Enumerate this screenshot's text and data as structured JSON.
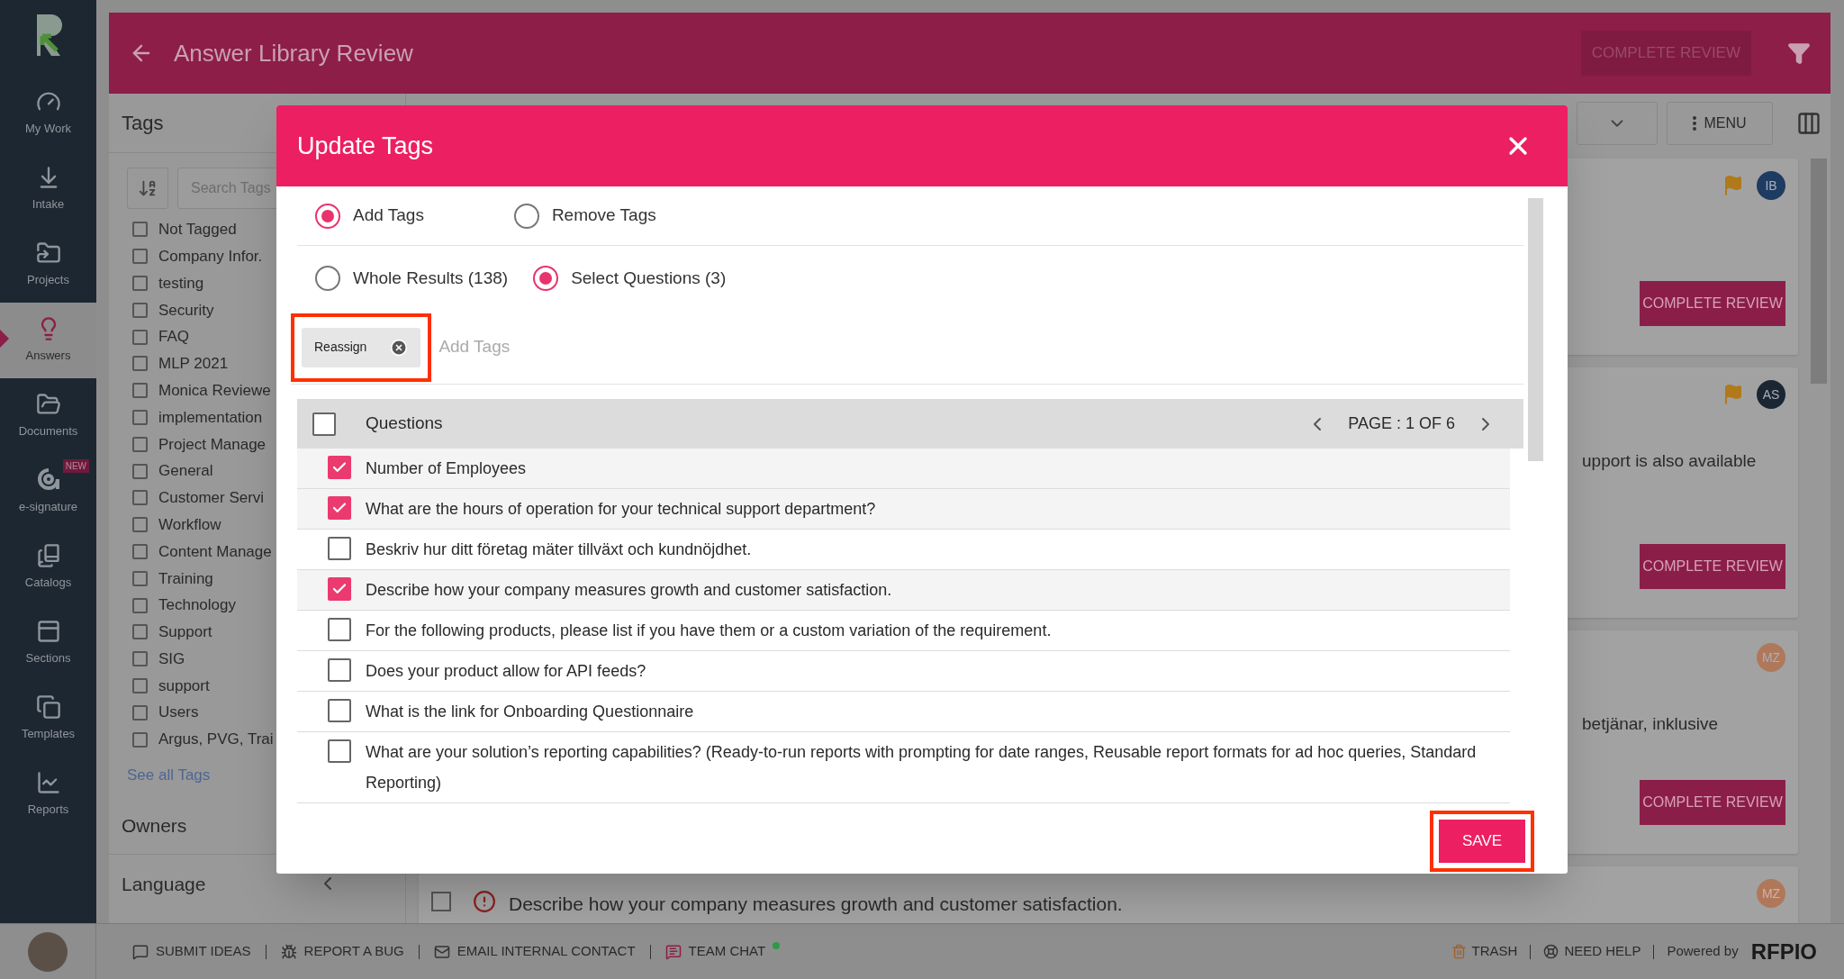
{
  "sidebar": {
    "items": [
      {
        "label": "My Work",
        "selected": false
      },
      {
        "label": "Intake",
        "selected": false
      },
      {
        "label": "Projects",
        "selected": false
      },
      {
        "label": "Answers",
        "selected": true
      },
      {
        "label": "Documents",
        "selected": false
      },
      {
        "label": "e-signature",
        "selected": false,
        "badge": "NEW"
      },
      {
        "label": "Catalogs",
        "selected": false
      },
      {
        "label": "Sections",
        "selected": false
      },
      {
        "label": "Templates",
        "selected": false
      },
      {
        "label": "Reports",
        "selected": false
      }
    ]
  },
  "header": {
    "title": "Answer Library Review",
    "action": "COMPLETE REVIEW"
  },
  "toolbar": {
    "menu": "MENU"
  },
  "tags_panel": {
    "title": "Tags",
    "search_placeholder": "Search Tags",
    "items": [
      {
        "label": "Not Tagged",
        "checked": false
      },
      {
        "label": "Company Infor.",
        "checked": false
      },
      {
        "label": "testing",
        "checked": false
      },
      {
        "label": "Security",
        "checked": false
      },
      {
        "label": "FAQ",
        "checked": false
      },
      {
        "label": "MLP 2021",
        "checked": false
      },
      {
        "label": "Monica Reviewe",
        "checked": false
      },
      {
        "label": "implementation",
        "checked": false
      },
      {
        "label": "Project Manage",
        "checked": false
      },
      {
        "label": "General",
        "checked": false
      },
      {
        "label": "Customer Servi",
        "checked": false
      },
      {
        "label": "Workflow",
        "checked": false
      },
      {
        "label": "Content Manage",
        "checked": false
      },
      {
        "label": "Training",
        "checked": false
      },
      {
        "label": "Technology",
        "checked": false
      },
      {
        "label": "Support",
        "checked": false
      },
      {
        "label": "SIG",
        "checked": false
      },
      {
        "label": "support",
        "checked": false
      },
      {
        "label": "Users",
        "checked": false
      },
      {
        "label": "Argus, PVG, Trai",
        "checked": false
      }
    ],
    "see_all": "See all Tags",
    "sections": [
      "Owners",
      "Language"
    ]
  },
  "cards": [
    {
      "kind": "review",
      "avatar": "IB",
      "color": "#1e3b61",
      "flagged": true,
      "button": "COMPLETE REVIEW"
    },
    {
      "kind": "review",
      "avatar": "AS",
      "color": "#1b2633",
      "flagged": true,
      "text": "upport is also available",
      "button": "COMPLETE REVIEW"
    },
    {
      "kind": "review",
      "avatar": "MZ",
      "color": "#b0785a",
      "flagged": false,
      "text": "betjänar, inklusive",
      "button": "COMPLETE REVIEW"
    },
    {
      "kind": "question",
      "avatar": "MZ",
      "color": "#b0785a",
      "checked": false,
      "text": "Describe how your company measures growth and customer satisfaction."
    }
  ],
  "modal": {
    "title": "Update Tags",
    "mode_options": [
      {
        "label": "Add Tags",
        "selected": true
      },
      {
        "label": "Remove Tags",
        "selected": false
      }
    ],
    "scope_options": [
      {
        "label": "Whole Results (138)",
        "selected": false
      },
      {
        "label": "Select Questions (3)",
        "selected": true
      }
    ],
    "tags": [
      "Reassign"
    ],
    "tag_placeholder": "Add Tags",
    "table": {
      "header": "Questions",
      "all_checked": false,
      "page": "PAGE : 1 OF 6",
      "rows": [
        {
          "text": "Number of Employees",
          "checked": true
        },
        {
          "text": "What are the hours of operation for your technical support department?",
          "checked": true
        },
        {
          "text": "Beskriv hur ditt företag mäter tillväxt och kundnöjdhet.",
          "checked": false
        },
        {
          "text": "Describe how your company measures growth and customer satisfaction.",
          "checked": true
        },
        {
          "text": "For the following products, please list if you have them or a custom variation of the requirement.",
          "checked": false
        },
        {
          "text": "Does your product allow for API feeds?",
          "checked": false
        },
        {
          "text": "What is the link for Onboarding Questionnaire",
          "checked": false
        },
        {
          "text": "What are your solution’s reporting capabilities? (Ready-to-run reports with prompting for date ranges, Reusable report formats for ad hoc queries, Standard Reporting)",
          "checked": false
        }
      ]
    },
    "save": "SAVE"
  },
  "footer": {
    "links": [
      {
        "label": "SUBMIT IDEAS",
        "online": false
      },
      {
        "label": "REPORT A BUG",
        "online": false
      },
      {
        "label": "EMAIL INTERNAL CONTACT",
        "online": false
      },
      {
        "label": "TEAM CHAT",
        "online": true
      }
    ],
    "right_links": [
      "TRASH",
      "NEED HELP"
    ],
    "powered_by": "Powered by",
    "brand": "RFPIO"
  }
}
